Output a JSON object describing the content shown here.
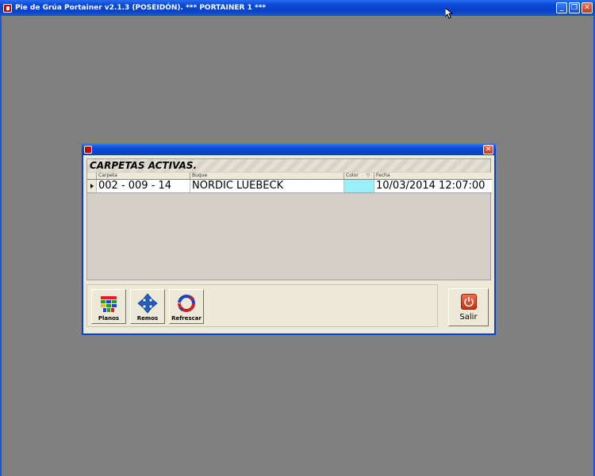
{
  "app": {
    "title": "Pie de Grúa Portainer v2.1.3 (POSEIDÓN).  *** PORTAINER 1 ***",
    "minimize_glyph": "_",
    "restore_glyph": "❐",
    "close_glyph": "✕"
  },
  "dialog": {
    "close_glyph": "✕",
    "panel_title": "CARPETAS ACTIVAS.",
    "table": {
      "columns": [
        "Carpeta",
        "Buque",
        "Color",
        "Fecha"
      ],
      "rows": [
        {
          "carpeta": "002 - 009 - 14",
          "buque": "NORDIC LUEBECK",
          "color": "#99f0f8",
          "fecha": "10/03/2014 12:07:00"
        }
      ]
    },
    "toolbar": {
      "planos_label": "Planos",
      "remos_label": "Remos",
      "refrescar_label": "Refrescar"
    },
    "salir_label": "Salir"
  },
  "colors": {
    "desktop": "#808080",
    "titlebar": "#0842c4",
    "dialog_bg": "#ece9d8"
  }
}
